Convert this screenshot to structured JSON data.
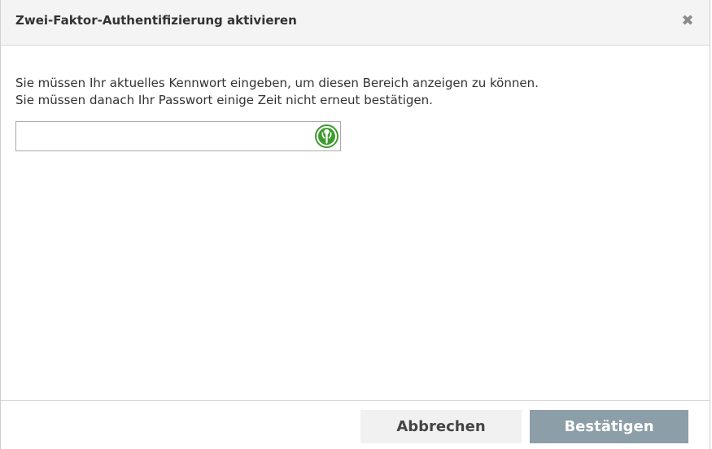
{
  "dialog": {
    "title": "Zwei-Faktor-Authentifizierung aktivieren",
    "close_icon": "close-icon",
    "close_glyph": "✖",
    "message_line_1": "Sie müssen Ihr aktuelles Kennwort eingeben, um diesen Bereich anzeigen zu können.",
    "message_line_2": "Sie müssen danach Ihr Passwort einige Zeit nicht erneut bestätigen.",
    "password": {
      "value": "",
      "placeholder": "",
      "icon": "password-manager-key-icon"
    },
    "cancel_label": "Abbrechen",
    "confirm_label": "Bestätigen"
  },
  "colors": {
    "header_bg": "#f4f4f4",
    "confirm_bg": "#8c9ea8",
    "cancel_bg": "#f1f1f1",
    "pw_icon_green": "#3f9b2f"
  }
}
